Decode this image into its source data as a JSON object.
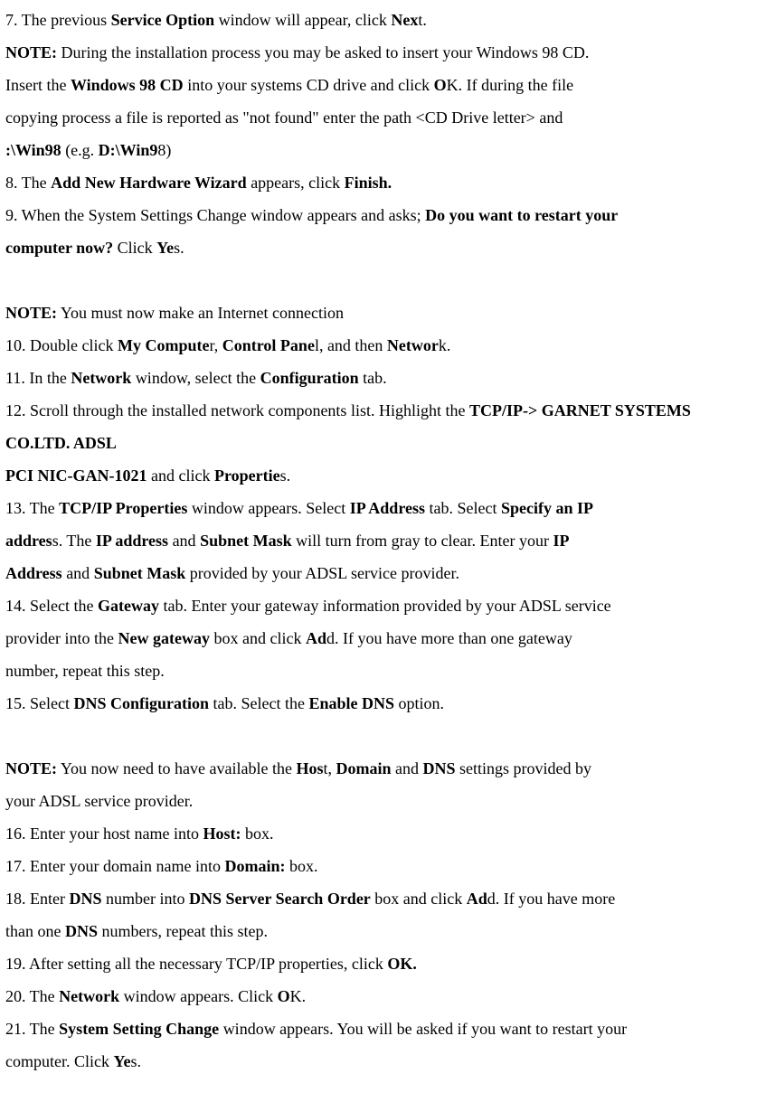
{
  "lines": {
    "l1a": "7. The previous ",
    "l1b": "Service Option",
    "l1c": " window will appear, click ",
    "l1d": "Nex",
    "l1e": "t.",
    "l2a": "NOTE:",
    "l2b": " During the installation process you may be asked to insert your Windows 98 CD.",
    "l3a": "Insert the ",
    "l3b": "Windows 98 CD",
    "l3c": " into your systems CD drive and click ",
    "l3d": "O",
    "l3e": "K. If during the file",
    "l4": "copying process a file is reported as \"not found\" enter the path <CD Drive letter> and",
    "l5a": ":\\Win98",
    "l5b": " (e.g. ",
    "l5c": "D:\\Win9",
    "l5d": "8)",
    "l6a": "8. The ",
    "l6b": "Add New Hardware Wizard",
    "l6c": " appears, click ",
    "l6d": "Finish.",
    "l7a": "9. When the System Settings Change window appears and asks; ",
    "l7b": "Do you want to restart your",
    "l8a": "computer now?",
    "l8b": " Click ",
    "l8c": "Ye",
    "l8d": "s.",
    "l9": " ",
    "l10a": "NOTE:",
    "l10b": " You must now make an Internet connection",
    "l11a": "10. Double click ",
    "l11b": "My Compute",
    "l11c": "r, ",
    "l11d": "Control Pane",
    "l11e": "l, and then ",
    "l11f": "Networ",
    "l11g": "k.",
    "l12a": "11. In the ",
    "l12b": "Network",
    "l12c": " window, select the ",
    "l12d": "Configuration",
    "l12e": " tab.",
    "l13a": "12. Scroll through the installed network components list. Highlight the ",
    "l13b": "TCP/IP-> GARNET SYSTEMS",
    "l14": "CO.LTD. ADSL",
    "l15a": "PCI NIC-GAN-1021",
    "l15b": " and click ",
    "l15c": "Propertie",
    "l15d": "s.",
    "l16a": "13. The ",
    "l16b": "TCP/IP Properties",
    "l16c": " window appears. Select ",
    "l16d": "IP Address",
    "l16e": " tab. Select ",
    "l16f": "Specify an IP",
    "l17a": "addres",
    "l17b": "s. The ",
    "l17c": "IP address",
    "l17d": " and ",
    "l17e": "Subnet Mask",
    "l17f": " will turn from gray to clear. Enter your ",
    "l17g": "IP",
    "l18a": "Address",
    "l18b": " and ",
    "l18c": "Subnet Mask",
    "l18d": " provided by your ADSL service provider.",
    "l19a": "14. Select the ",
    "l19b": "Gateway",
    "l19c": " tab. Enter your gateway information provided by your ADSL service",
    "l20a": "provider into the ",
    "l20b": "New gateway",
    "l20c": " box and click ",
    "l20d": "Ad",
    "l20e": "d. If you have more than one gateway",
    "l21": "number, repeat this step.",
    "l22a": "15. Select ",
    "l22b": "DNS Configuration",
    "l22c": " tab. Select the ",
    "l22d": "Enable DNS",
    "l22e": " option.",
    "l23": " ",
    "l24a": "NOTE:",
    "l24b": " You now need to have available the ",
    "l24c": "Hos",
    "l24d": "t, ",
    "l24e": "Domain",
    "l24f": " and ",
    "l24g": "DNS",
    "l24h": " settings provided by",
    "l25": "your ADSL service provider.",
    "l26a": "16. Enter your host name into ",
    "l26b": "Host:",
    "l26c": " box.",
    "l27a": "17. Enter your domain name into ",
    "l27b": "Domain:",
    "l27c": " box.",
    "l28a": "18. Enter ",
    "l28b": "DNS",
    "l28c": " number into ",
    "l28d": "DNS Server Search Order",
    "l28e": " box and click ",
    "l28f": "Ad",
    "l28g": "d. If you have more",
    "l29a": "than one ",
    "l29b": "DNS",
    "l29c": " numbers, repeat this step.",
    "l30a": "19. After setting all the necessary TCP/IP properties, click ",
    "l30b": "OK.",
    "l31a": "20. The ",
    "l31b": "Network",
    "l31c": " window appears. Click ",
    "l31d": "O",
    "l31e": "K.",
    "l32a": "21. The ",
    "l32b": "System Setting Change",
    "l32c": " window appears. You will be asked if you want to restart your",
    "l33a": "computer. Click ",
    "l33b": "Ye",
    "l33c": "s."
  }
}
